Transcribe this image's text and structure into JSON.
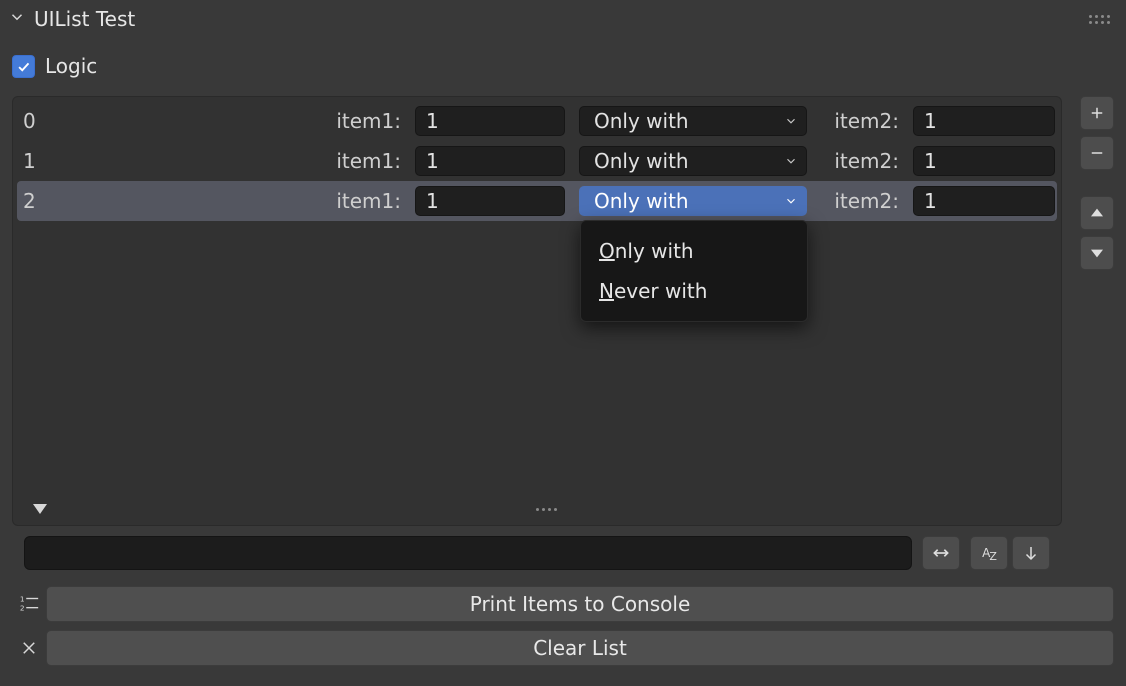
{
  "panel": {
    "title": "UIList Test",
    "checkbox": {
      "label": "Logic",
      "checked": true
    }
  },
  "list": {
    "rows": [
      {
        "index": "0",
        "item1_label": "item1:",
        "item1_val": "1",
        "mode": "Only with",
        "item2_label": "item2:",
        "item2_val": "1",
        "selected": false
      },
      {
        "index": "1",
        "item1_label": "item1:",
        "item1_val": "1",
        "mode": "Only with",
        "item2_label": "item2:",
        "item2_val": "1",
        "selected": false
      },
      {
        "index": "2",
        "item1_label": "item1:",
        "item1_val": "1",
        "mode": "Only with",
        "item2_label": "item2:",
        "item2_val": "1",
        "selected": true
      }
    ],
    "dropdown_open_index": 2,
    "dropdown_options": [
      "Only with",
      "Never with"
    ]
  },
  "side": {
    "add": "+",
    "remove": "-"
  },
  "search": {
    "value": ""
  },
  "buttons": {
    "print": "Print Items to Console",
    "clear": "Clear List"
  }
}
